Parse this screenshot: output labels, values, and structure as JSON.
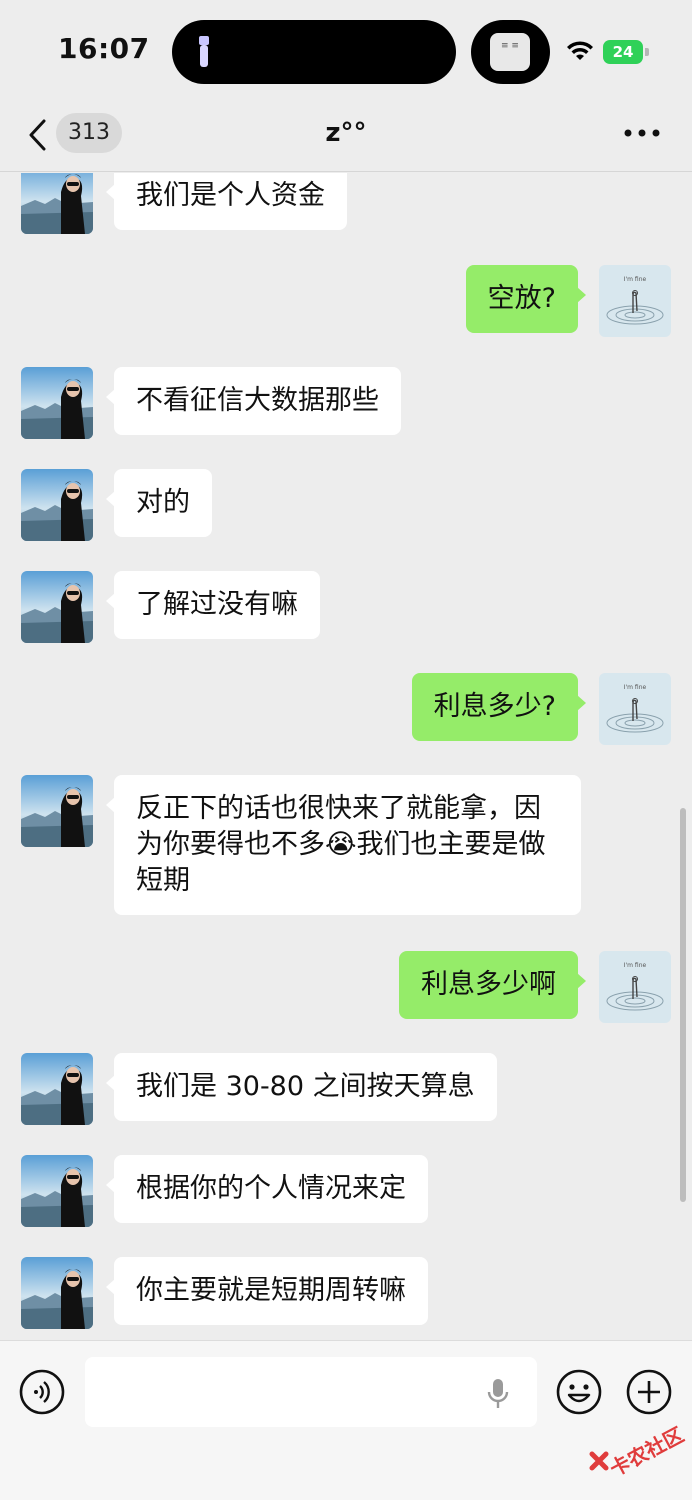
{
  "status_bar": {
    "time": "16:07",
    "battery": "24"
  },
  "nav": {
    "unread_count": "313",
    "title": "z°°"
  },
  "messages": [
    {
      "side": "in",
      "text": "我们是个人资金"
    },
    {
      "side": "out",
      "text": "空放?"
    },
    {
      "side": "in",
      "text": "不看征信大数据那些"
    },
    {
      "side": "in",
      "text": "对的"
    },
    {
      "side": "in",
      "text": "了解过没有嘛"
    },
    {
      "side": "out",
      "text": "利息多少?"
    },
    {
      "side": "in",
      "text": "反正下的话也很快来了就能拿，因为你要得也不多😭我们也主要是做短期"
    },
    {
      "side": "out",
      "text": "利息多少啊"
    },
    {
      "side": "in",
      "text": "我们是 30-80 之间按天算息"
    },
    {
      "side": "in",
      "text": "根据你的个人情况来定"
    },
    {
      "side": "in",
      "text": "你主要就是短期周转嘛"
    }
  ],
  "input": {
    "placeholder": ""
  },
  "watermark": {
    "text": "卡农社区"
  },
  "icons": {
    "back": "chevron-left-icon",
    "more": "more-dots-icon",
    "voice": "voice-icon",
    "mic": "mic-icon",
    "emoji": "emoji-icon",
    "plus": "plus-icon",
    "wifi": "wifi-icon"
  },
  "colors": {
    "background": "#ededed",
    "incoming_bubble": "#ffffff",
    "outgoing_bubble": "#95ec69",
    "battery": "#2fd158",
    "watermark": "#e03c3c"
  }
}
